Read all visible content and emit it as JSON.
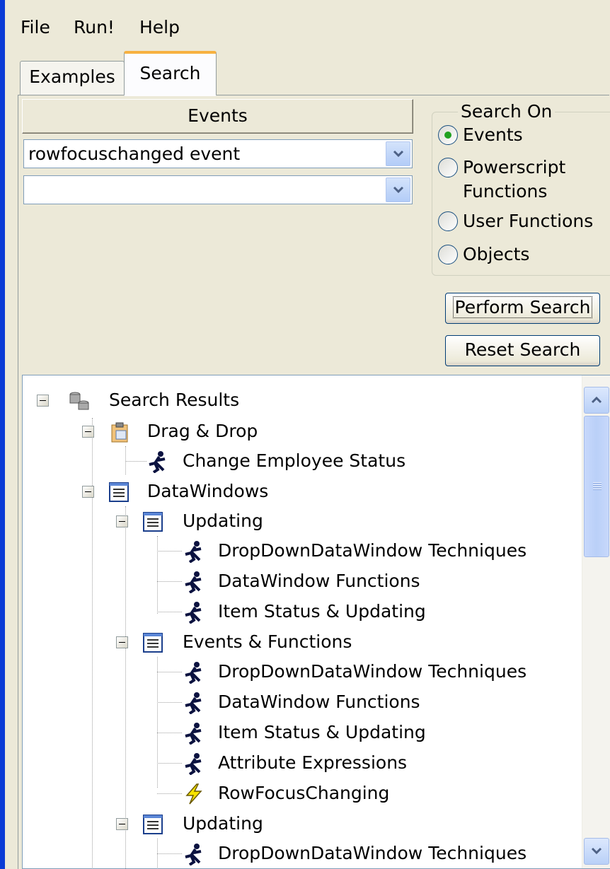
{
  "menu": {
    "file": "File",
    "run": "Run!",
    "help": "Help"
  },
  "tabs": {
    "examples": "Examples",
    "search": "Search"
  },
  "events_header": "Events",
  "combo1": {
    "value": "rowfocuschanged event"
  },
  "combo2": {
    "value": ""
  },
  "search_on": {
    "legend": "Search On",
    "options": {
      "events": "Events",
      "powerscript_line1": "Powerscript",
      "powerscript_line2": "Functions",
      "user_functions": "User Functions",
      "objects": "Objects"
    },
    "selected": "Events"
  },
  "buttons": {
    "perform": "Perform Search",
    "reset": "Reset Search"
  },
  "tree": {
    "root": "Search Results",
    "items": [
      "Drag & Drop",
      "Change Employee Status",
      "DataWindows",
      "Updating",
      "DropDownDataWindow Techniques",
      "DataWindow Functions",
      "Item Status & Updating",
      "Events & Functions",
      "DropDownDataWindow Techniques",
      "DataWindow Functions",
      "Item Status & Updating",
      "Attribute Expressions",
      "RowFocusChanging",
      "Updating",
      "DropDownDataWindow Techniques"
    ]
  },
  "colors": {
    "title_blue": "#0a3bd6",
    "tab_highlight": "#f7b140",
    "radio_selected": "#21a121"
  }
}
